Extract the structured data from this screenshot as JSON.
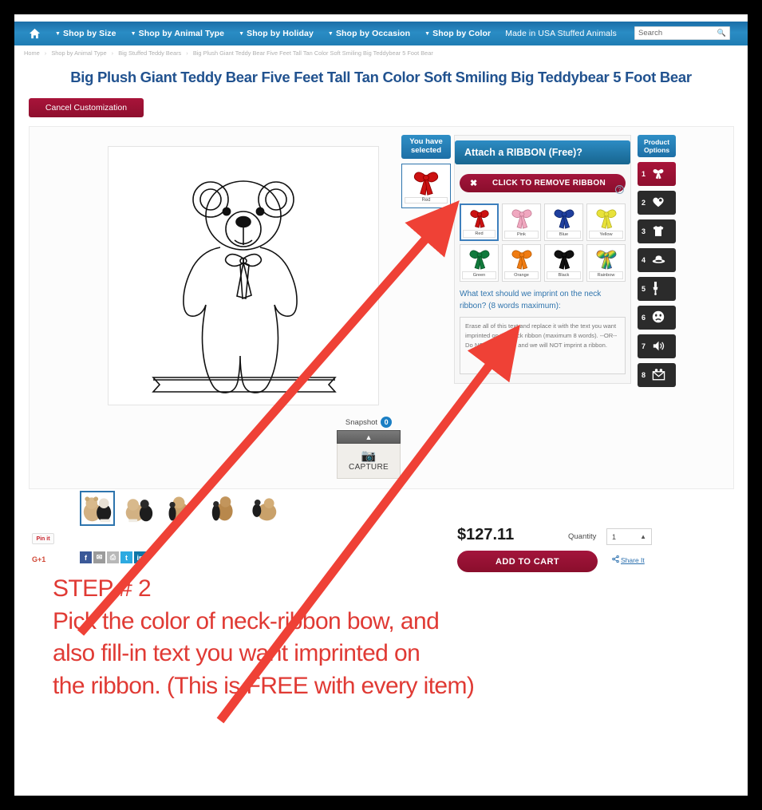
{
  "nav": {
    "home_icon": "home-icon",
    "items": [
      {
        "label": "Shop by Size",
        "caret": "▾"
      },
      {
        "label": "Shop by Animal Type",
        "caret": "▾"
      },
      {
        "label": "Shop by Holiday",
        "caret": "▾"
      },
      {
        "label": "Shop by Occasion",
        "caret": "▾"
      },
      {
        "label": "Shop by Color",
        "caret": "▾"
      },
      {
        "label": "Made in USA Stuffed Animals",
        "caret": ""
      }
    ],
    "search_placeholder": "Search",
    "search_icon": "magnifier-icon",
    "bar_color": "#2180b8"
  },
  "breadcrumb": {
    "items": [
      "Home",
      "Shop by Animal Type",
      "Big Stuffed Teddy Bears",
      "Big Plush Giant Teddy Bear Five Feet Tall Tan Color Soft Smiling Big Teddybear 5 Foot Bear"
    ],
    "separator": "›"
  },
  "page": {
    "title": "Big Plush Giant Teddy Bear Five Feet Tall Tan Color Soft Smiling Big Teddybear 5 Foot Bear",
    "title_color": "#21528f",
    "cancel_label": "Cancel Customization"
  },
  "snapshot": {
    "label": "Snapshot",
    "count": "0",
    "collapse_icon": "chevron-up-icon",
    "capture_label": "CAPTURE",
    "camera_icon": "camera-icon"
  },
  "selected_panel": {
    "heading": "You have selected",
    "thumb_caption": "Red"
  },
  "ribbon_panel": {
    "heading": "Attach a RIBBON (Free)?",
    "remove_label": "CLICK TO REMOVE RIBBON",
    "remove_icon": "x-icon",
    "help_icon": "question-mark-icon",
    "colors": [
      {
        "name": "Red",
        "hex": "#cc1111",
        "selected": true
      },
      {
        "name": "Pink",
        "hex": "#f0a8c0",
        "selected": false
      },
      {
        "name": "Blue",
        "hex": "#1f3f9e",
        "selected": false
      },
      {
        "name": "Yellow",
        "hex": "#e8e23a",
        "selected": false
      },
      {
        "name": "Green",
        "hex": "#107a3c",
        "selected": false
      },
      {
        "name": "Orange",
        "hex": "#f07c12",
        "selected": false
      },
      {
        "name": "Black",
        "hex": "#111111",
        "selected": false
      },
      {
        "name": "Rainbow",
        "hex": "rainbow",
        "selected": false
      }
    ],
    "imprint_question": "What text should we imprint on the neck ribbon? (8 words maximum):",
    "imprint_placeholder": "Erase all of this text and replace it with the text you want imprinted on the neck ribbon (maximum 8 words). --OR-- Do NOTHING here and we will NOT imprint a ribbon."
  },
  "product_options": {
    "heading": "Product Options",
    "items": [
      {
        "num": "1",
        "icon": "ribbon-bow-icon",
        "active": true
      },
      {
        "num": "2",
        "icon": "heart-paw-icon",
        "active": false
      },
      {
        "num": "3",
        "icon": "tshirt-icon",
        "active": false
      },
      {
        "num": "4",
        "icon": "hat-icon",
        "active": false
      },
      {
        "num": "5",
        "icon": "zipper-pin-icon",
        "active": false
      },
      {
        "num": "6",
        "icon": "face-icon",
        "active": false
      },
      {
        "num": "7",
        "icon": "sound-speaker-icon",
        "active": false
      },
      {
        "num": "8",
        "icon": "envelope-icon",
        "active": false
      }
    ]
  },
  "purchase": {
    "price": "$127.11",
    "quantity_label": "Quantity",
    "quantity_value": "1",
    "quantity_stepper_icon": "caret-up-icon",
    "add_to_cart_label": "ADD TO CART",
    "share_label": "Share It",
    "share_icon": "share-icon"
  },
  "gallery": {
    "thumbnails": [
      {
        "name": "bear-photo-1",
        "selected": true
      },
      {
        "name": "bear-photo-2",
        "selected": false
      },
      {
        "name": "bear-photo-3",
        "selected": false
      },
      {
        "name": "bear-photo-4",
        "selected": false
      },
      {
        "name": "bear-photo-5",
        "selected": false
      }
    ]
  },
  "social": {
    "pinit_label": "Pin it",
    "gplus_label": "G+1",
    "buttons": [
      {
        "name": "facebook-icon",
        "glyph": "f"
      },
      {
        "name": "email-icon",
        "glyph": "✉"
      },
      {
        "name": "print-icon",
        "glyph": "⎙"
      },
      {
        "name": "twitter-icon",
        "glyph": "t"
      },
      {
        "name": "linkedin-icon",
        "glyph": "in"
      }
    ]
  },
  "annotation": {
    "color": "#e03a34",
    "line1": "STEP # 2",
    "line2": "Pick the color of neck-ribbon bow, and",
    "line3": "also fill-in text you want imprinted on",
    "line4": "the ribbon. (This is FREE with every item)"
  }
}
